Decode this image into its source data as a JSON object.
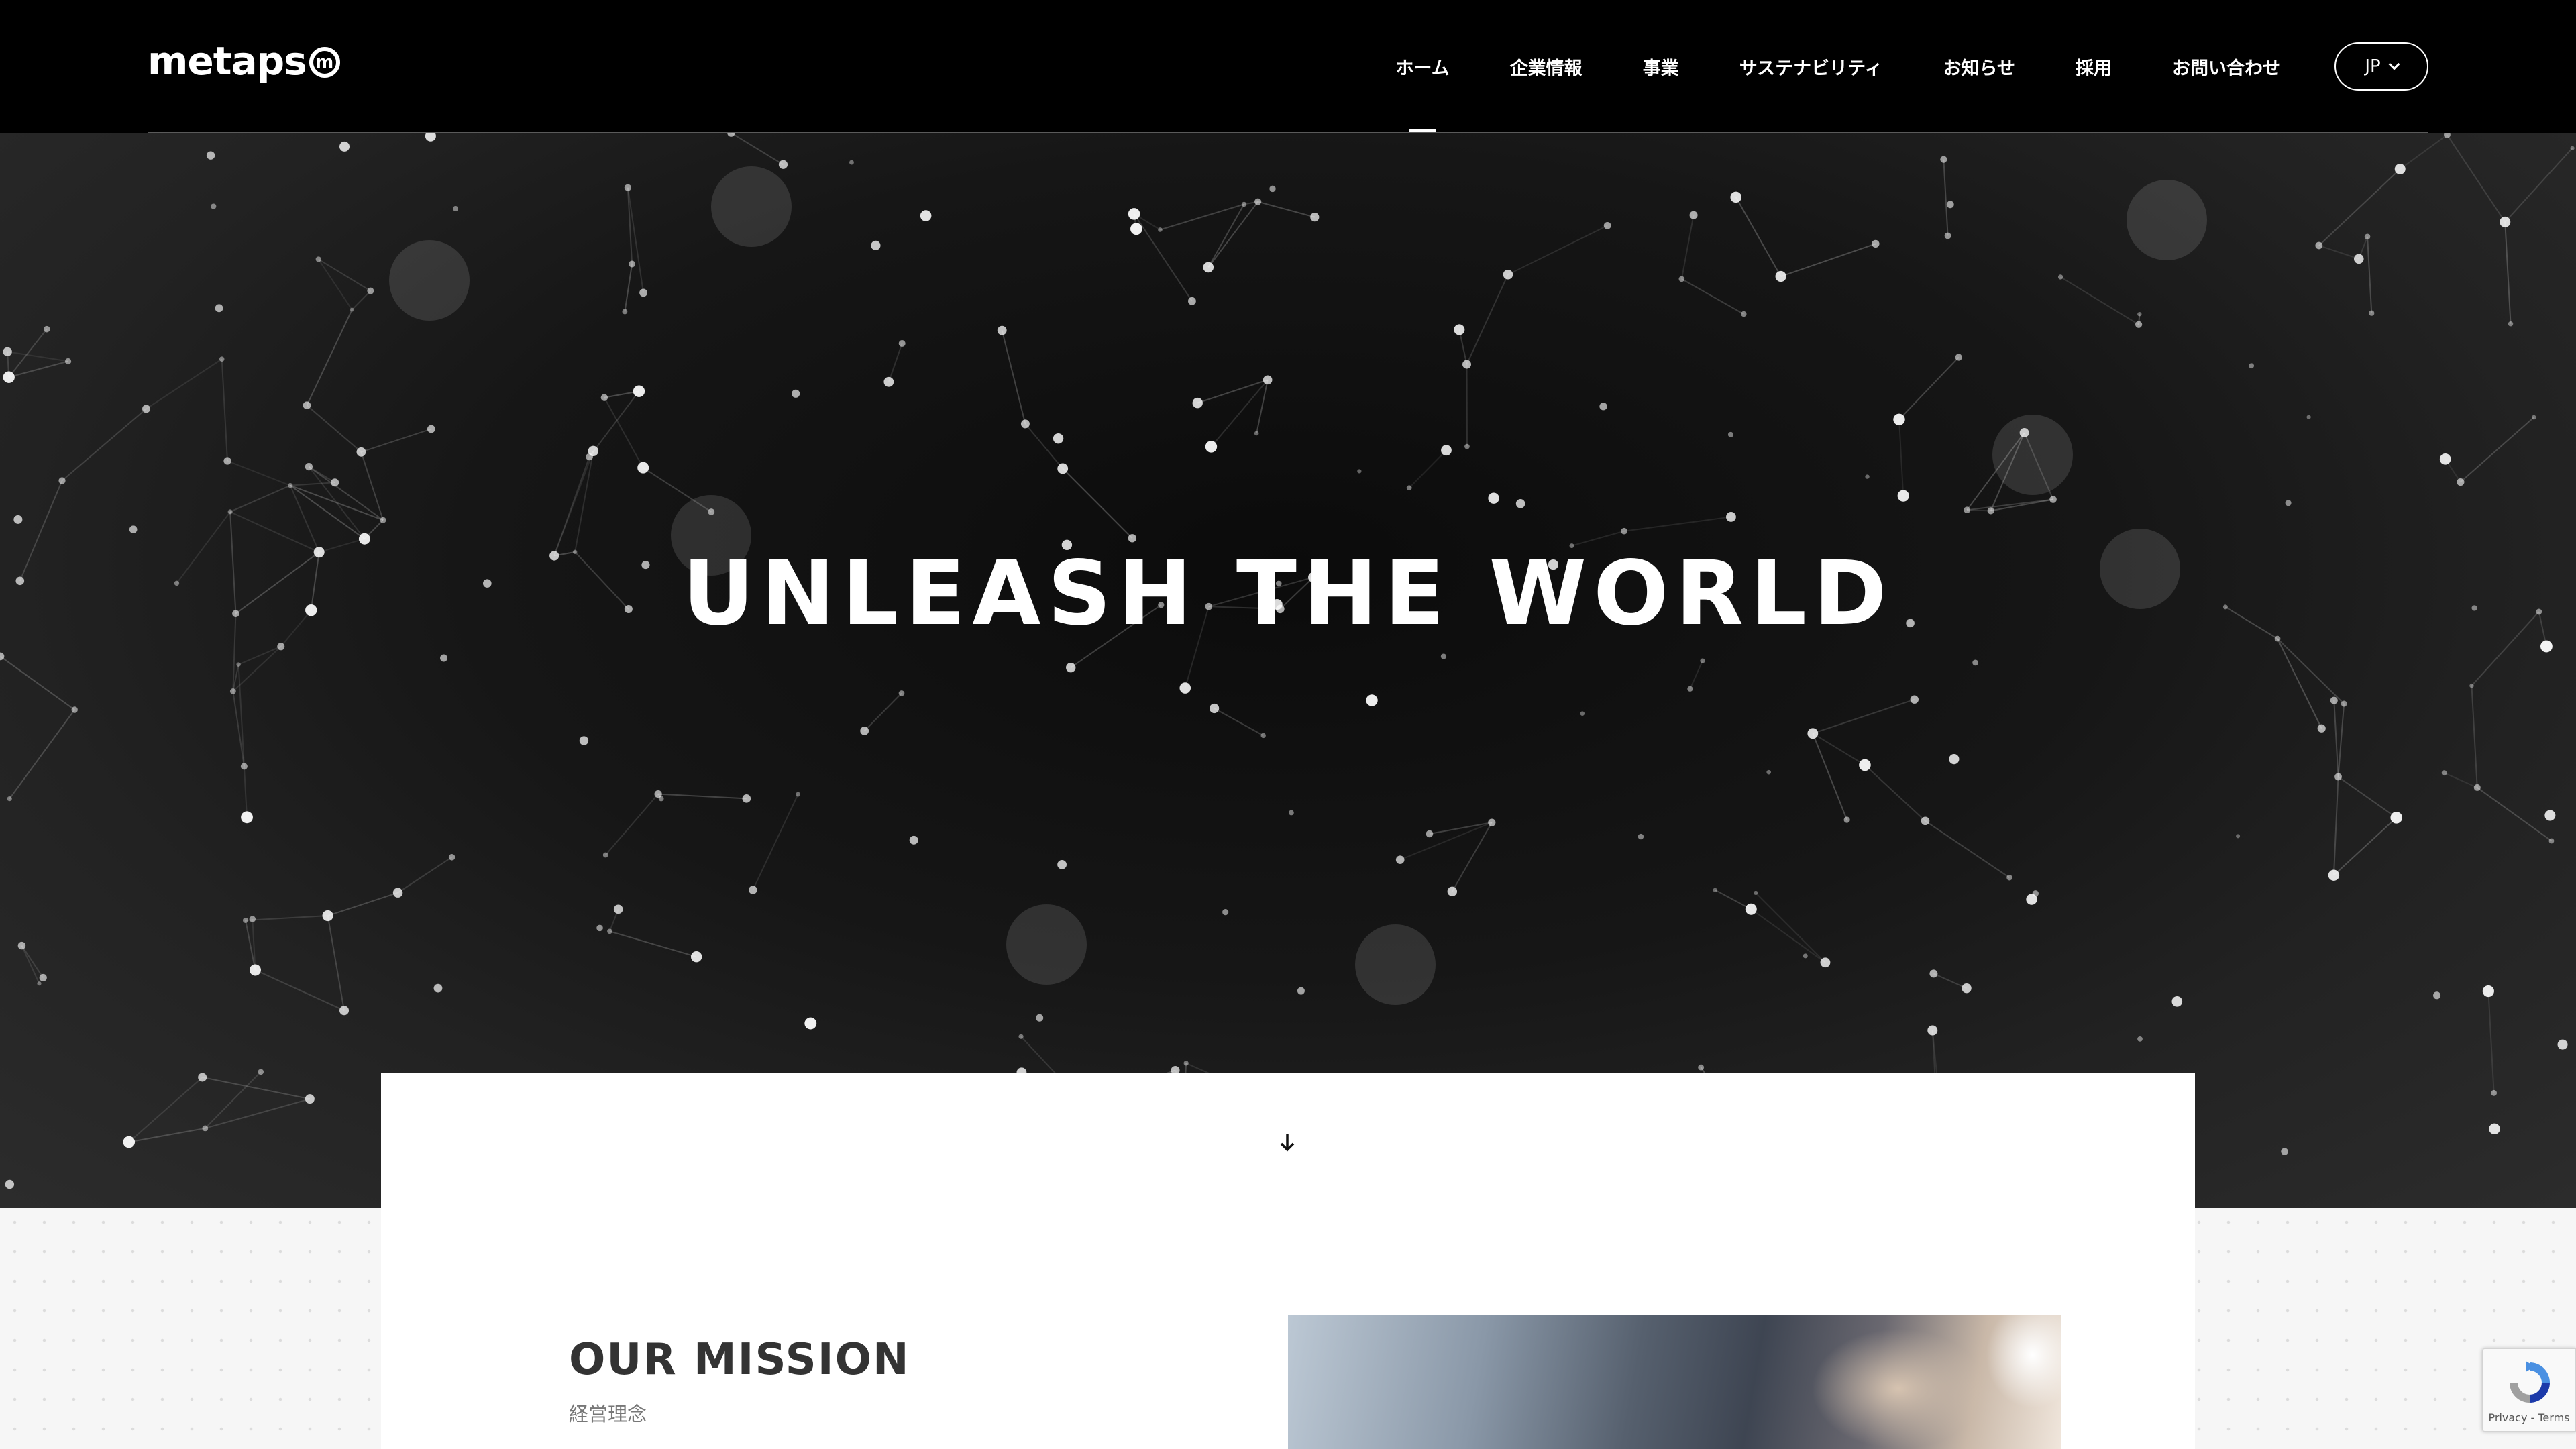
{
  "brand": {
    "logo_text": "metaps",
    "logo_mark": "m"
  },
  "nav": {
    "items": [
      {
        "label": "ホーム",
        "active": true
      },
      {
        "label": "企業情報",
        "active": false
      },
      {
        "label": "事業",
        "active": false
      },
      {
        "label": "サステナビリティ",
        "active": false
      },
      {
        "label": "お知らせ",
        "active": false
      },
      {
        "label": "採用",
        "active": false
      },
      {
        "label": "お問い合わせ",
        "active": false
      }
    ],
    "language": "JP"
  },
  "hero": {
    "title": "UNLEASH THE WORLD",
    "scroll_icon": "arrow-down-icon"
  },
  "mission": {
    "title": "OUR MISSION",
    "subtitle": "経営理念"
  },
  "recaptcha": {
    "links": "Privacy - Terms"
  },
  "colors": {
    "header_bg": "#000000",
    "hero_bg": "#111111",
    "card_bg": "#ffffff",
    "text_dark": "#333333"
  }
}
